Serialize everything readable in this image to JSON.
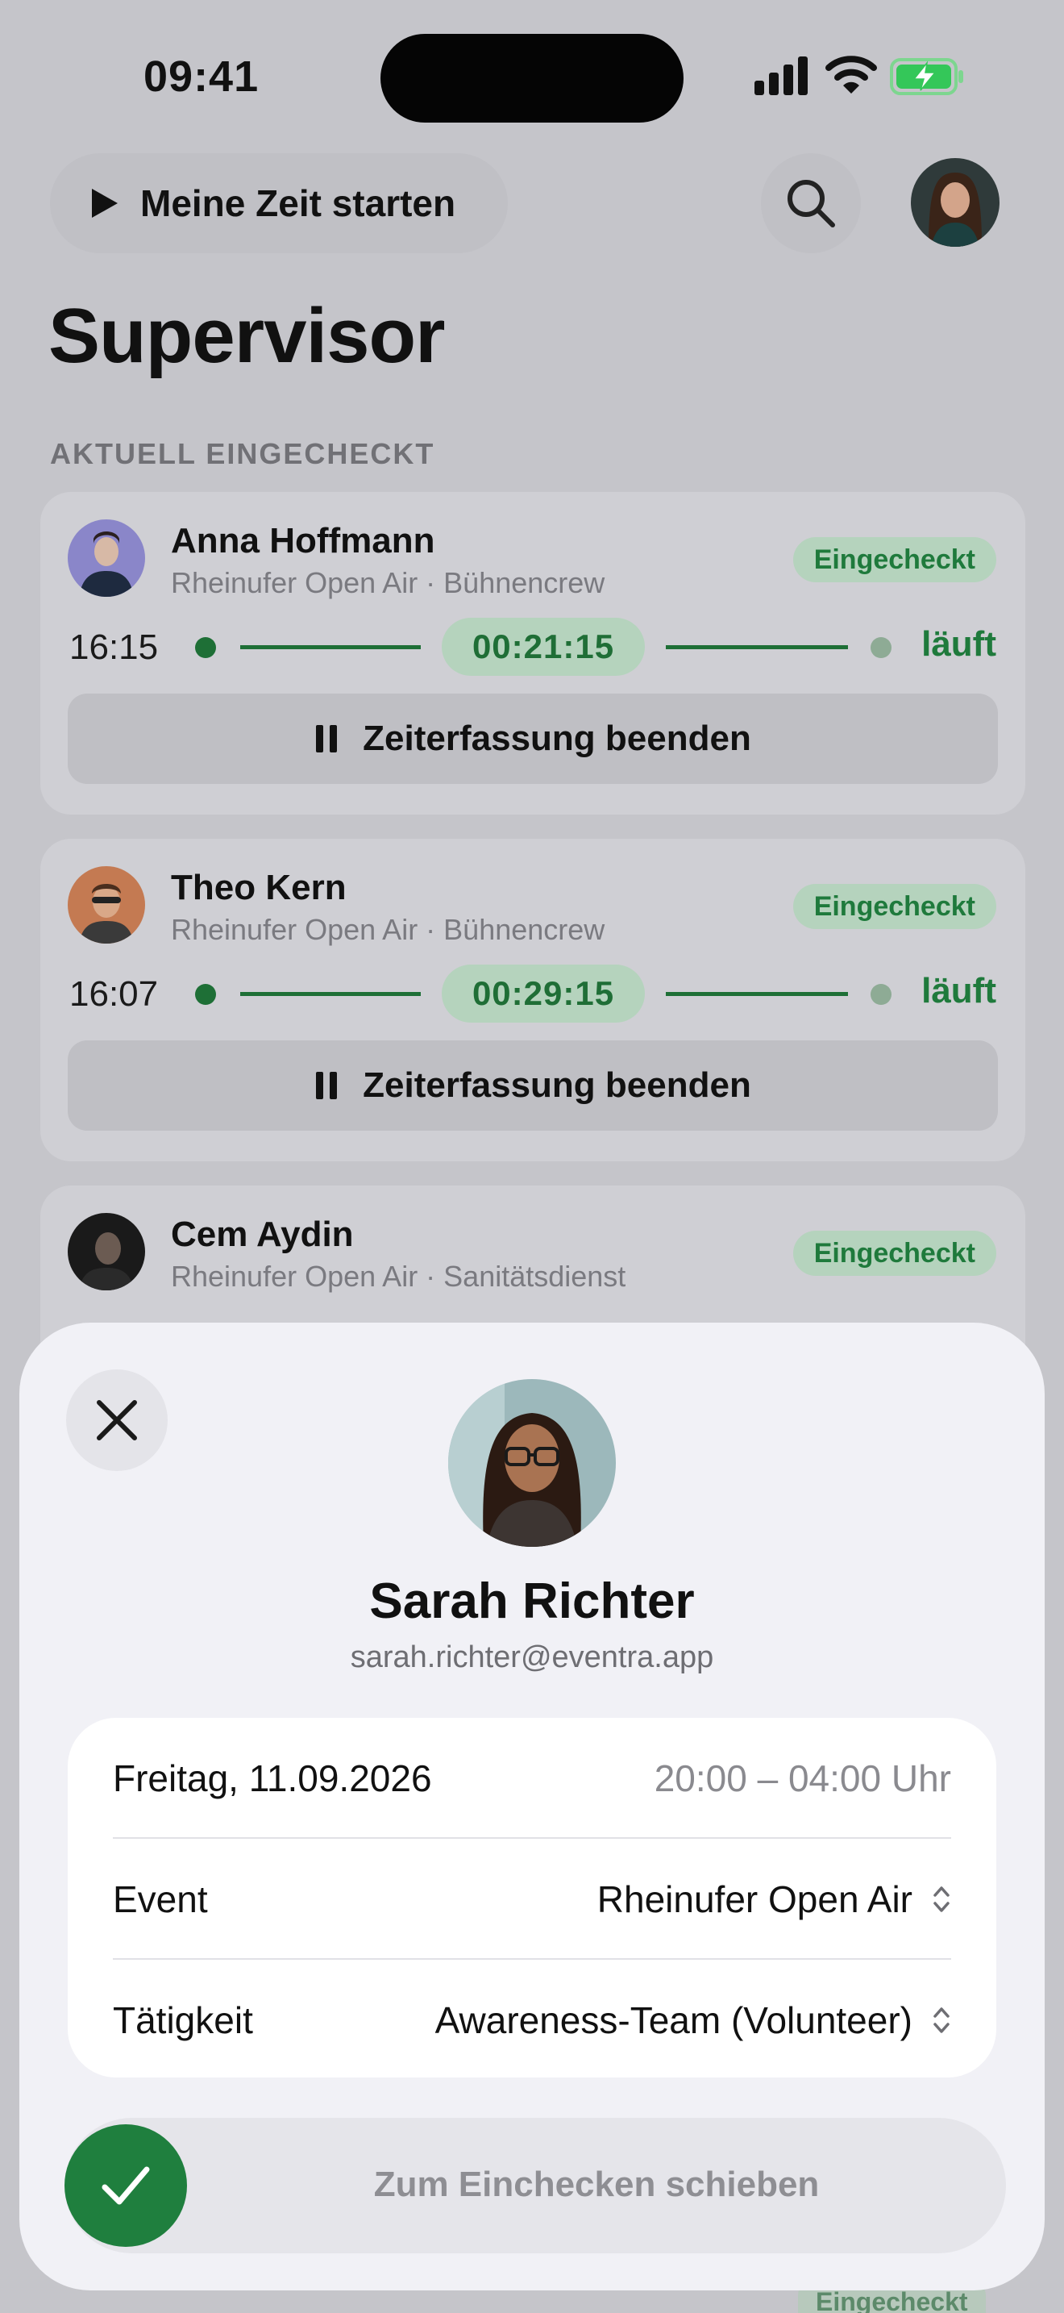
{
  "status_bar": {
    "time": "09:41",
    "signal_icon": "cellular-signal-icon",
    "wifi_icon": "wifi-icon",
    "battery_icon": "battery-charging-icon",
    "battery_color": "#34c759"
  },
  "header": {
    "start_label": "Meine Zeit starten",
    "title": "Supervisor"
  },
  "section": {
    "label": "AKTUELL EINGECHECKT"
  },
  "cards": [
    {
      "name": "Anna Hoffmann",
      "subtitle": "Rheinufer Open Air · Bühnencrew",
      "badge": "Eingecheckt",
      "start": "16:15",
      "timer": "00:21:15",
      "status": "läuft",
      "stop_label": "Zeiterfassung beenden"
    },
    {
      "name": "Theo Kern",
      "subtitle": "Rheinufer Open Air · Bühnencrew",
      "badge": "Eingecheckt",
      "start": "16:07",
      "timer": "00:29:15",
      "status": "läuft",
      "stop_label": "Zeiterfassung beenden"
    },
    {
      "name": "Cem Aydin",
      "subtitle": "Rheinufer Open Air · Sanitätsdienst",
      "badge": "Eingecheckt"
    }
  ],
  "sheet": {
    "name": "Sarah Richter",
    "email": "sarah.richter@eventra.app",
    "date": "Freitag, 11.09.2026",
    "time_range": "20:00 – 04:00 Uhr",
    "event_label": "Event",
    "event_value": "Rheinufer Open Air",
    "activity_label": "Tätigkeit",
    "activity_value": "Awareness-Team (Volunteer)",
    "slider_label": "Zum Einchecken schieben"
  },
  "peek": {
    "badge": "Eingecheckt"
  },
  "colors": {
    "accent_green": "#1f7f3e",
    "badge_bg": "#b5d3bd",
    "sheet_bg": "#f1f1f6"
  }
}
